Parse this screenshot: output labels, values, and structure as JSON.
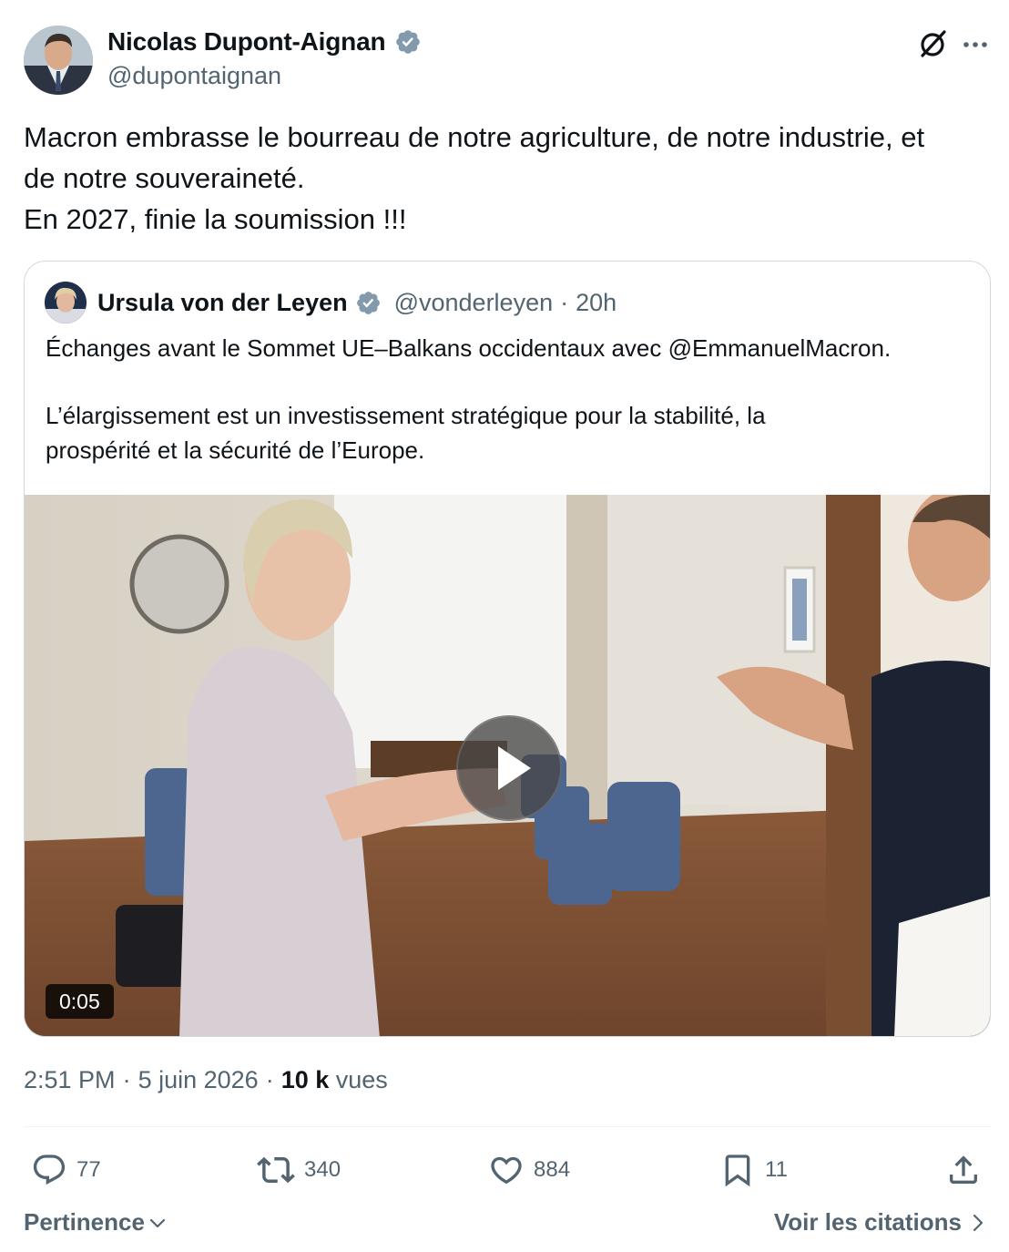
{
  "author": {
    "name": "Nicolas Dupont-Aignan",
    "handle": "@dupontaignan",
    "verified": true
  },
  "tweet": {
    "lines": [
      "Macron embrasse le bourreau de notre agriculture, de notre industrie, et",
      "de notre souveraineté.",
      "En 2027, finie la soumission !!!"
    ]
  },
  "quote": {
    "author_name": "Ursula von der Leyen",
    "handle": "@vonderleyen",
    "separator": "·",
    "time": "20h",
    "lines": [
      "Échanges avant le Sommet UE–Balkans occidentaux avec @EmmanuelMacron.",
      "",
      "L’élargissement est un investissement stratégique pour la stabilité, la",
      "prospérité et la sécurité de l’Europe."
    ],
    "video": {
      "duration": "0:05"
    }
  },
  "meta": {
    "time": "2:51 PM",
    "sep1": "·",
    "date": "5 juin 2026",
    "sep2": "·",
    "views_count": "10 k",
    "views_label": "vues"
  },
  "actions": {
    "replies": "77",
    "reposts": "340",
    "likes": "884",
    "bookmarks": "11"
  },
  "footer": {
    "sort_label": "Pertinence",
    "quotes_link": "Voir les citations"
  },
  "colors": {
    "text_primary": "#0f1419",
    "text_secondary": "#536471",
    "verified_gray": "#829aab",
    "border": "#cfd9de"
  },
  "icons": [
    "verified-badge-icon",
    "grok-icon",
    "more-icon",
    "play-icon",
    "reply-icon",
    "repost-icon",
    "like-icon",
    "bookmark-icon",
    "share-icon",
    "chevron-down-icon",
    "chevron-right-icon"
  ]
}
